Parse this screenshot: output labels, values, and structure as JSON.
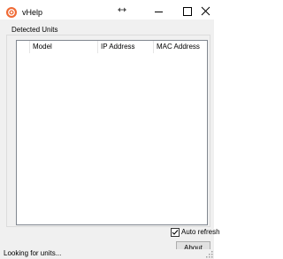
{
  "window": {
    "title": "vHelp"
  },
  "group": {
    "legend": "Detected Units"
  },
  "list": {
    "columns": [
      "",
      "Model",
      "IP Address",
      "MAC Address"
    ]
  },
  "options": {
    "auto_refresh_label": "Auto refresh",
    "auto_refresh_checked": true
  },
  "buttons": {
    "about_label": "About"
  },
  "status": {
    "text": "Looking for units..."
  },
  "colors": {
    "accent": "#ef6a35",
    "border": "#828790"
  },
  "icons": {
    "app": "app-logo-icon",
    "resize": "resize-horizontal-icon",
    "minimize": "minimize-icon",
    "maximize": "maximize-icon",
    "close": "close-icon",
    "check": "checkmark-icon",
    "grip": "size-grip-icon"
  }
}
